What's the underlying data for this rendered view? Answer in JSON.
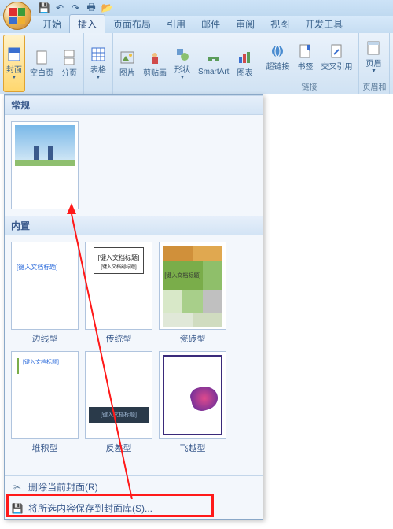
{
  "qat": {
    "save": "💾",
    "undo": "↶",
    "redo": "↷",
    "print": "🖶",
    "open": "📂"
  },
  "tabs": [
    "开始",
    "插入",
    "页面布局",
    "引用",
    "邮件",
    "审阅",
    "视图",
    "开发工具"
  ],
  "active_tab_index": 1,
  "ribbon": {
    "pages": {
      "cover": "封面",
      "blank": "空白页",
      "break": "分页"
    },
    "tables": {
      "table": "表格"
    },
    "illus": {
      "picture": "图片",
      "clipart": "剪贴画",
      "shapes": "形状",
      "smartart": "SmartArt",
      "chart": "图表"
    },
    "links": {
      "hyperlink": "超链接",
      "bookmark": "书签",
      "crossref": "交叉引用",
      "group": "链接"
    },
    "hf": {
      "header": "页眉",
      "group": "页眉和"
    }
  },
  "dropdown": {
    "section1": "常规",
    "section2": "内置",
    "builtin": [
      {
        "label": "边线型",
        "placeholder": "[键入文档标题]"
      },
      {
        "label": "传统型",
        "placeholder": "[键入文档标题]",
        "sub": "[键入文档副标题]"
      },
      {
        "label": "瓷砖型",
        "placeholder": "[键入文档标题]"
      },
      {
        "label": "堆积型",
        "placeholder": "[键入文档标题]"
      },
      {
        "label": "反差型",
        "placeholder": "[键入文档标题]"
      },
      {
        "label": "飞越型"
      }
    ],
    "remove": "删除当前封面(R)",
    "save": "将所选内容保存到封面库(S)..."
  }
}
